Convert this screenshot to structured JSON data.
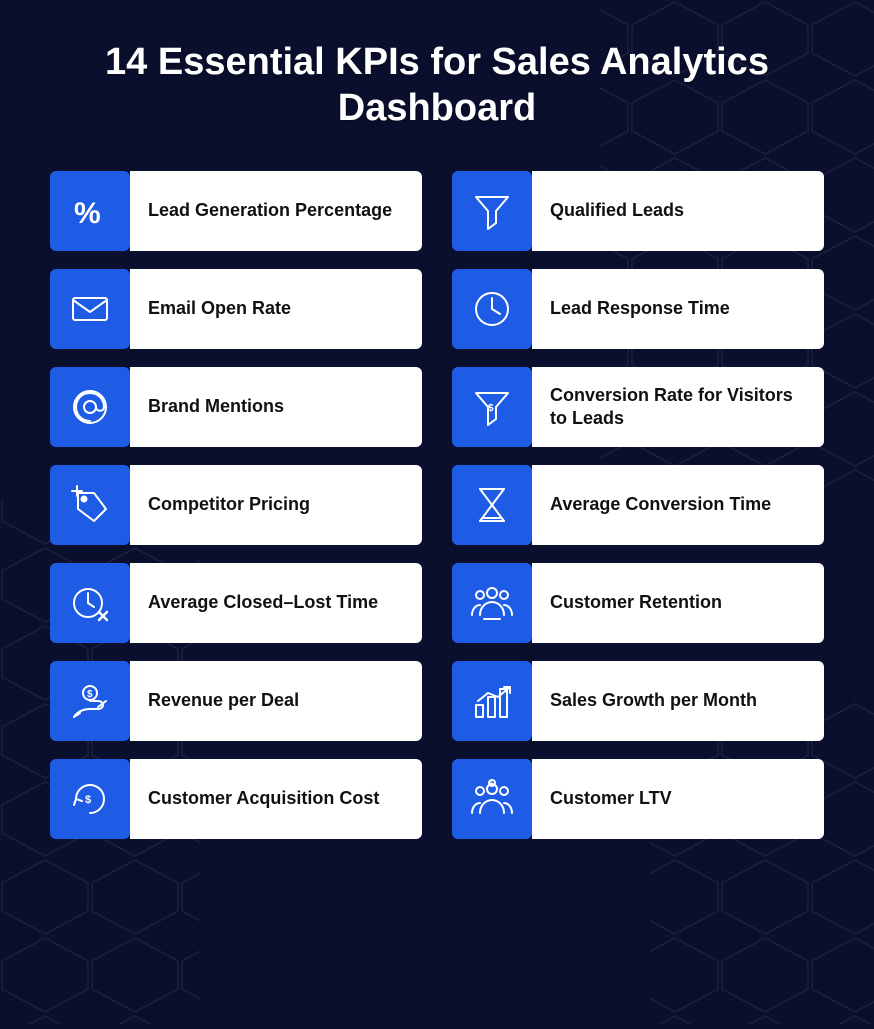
{
  "title": "14 Essential KPIs for Sales Analytics Dashboard",
  "kpis": [
    {
      "id": "lead-generation-percentage",
      "label": "Lead Generation Percentage",
      "icon": "percent"
    },
    {
      "id": "qualified-leads",
      "label": "Qualified Leads",
      "icon": "funnel"
    },
    {
      "id": "email-open-rate",
      "label": "Email Open Rate",
      "icon": "email"
    },
    {
      "id": "lead-response-time",
      "label": "Lead Response Time",
      "icon": "clock"
    },
    {
      "id": "brand-mentions",
      "label": "Brand Mentions",
      "icon": "at"
    },
    {
      "id": "conversion-rate",
      "label": "Conversion Rate for Visitors to Leads",
      "icon": "funnel-dollar"
    },
    {
      "id": "competitor-pricing",
      "label": "Competitor Pricing",
      "icon": "price-tag"
    },
    {
      "id": "average-conversion-time",
      "label": "Average Conversion Time",
      "icon": "hourglass"
    },
    {
      "id": "average-closed-lost-time",
      "label": "Average Closed–Lost Time",
      "icon": "clock-x"
    },
    {
      "id": "customer-retention",
      "label": "Customer Retention",
      "icon": "customers"
    },
    {
      "id": "revenue-per-deal",
      "label": "Revenue per Deal",
      "icon": "money-hand"
    },
    {
      "id": "sales-growth-per-month",
      "label": "Sales Growth per Month",
      "icon": "chart-up"
    },
    {
      "id": "customer-acquisition-cost",
      "label": "Customer Acquisition Cost",
      "icon": "cycle-dollar"
    },
    {
      "id": "customer-ltv",
      "label": "Customer LTV",
      "icon": "customers-dollar"
    }
  ]
}
